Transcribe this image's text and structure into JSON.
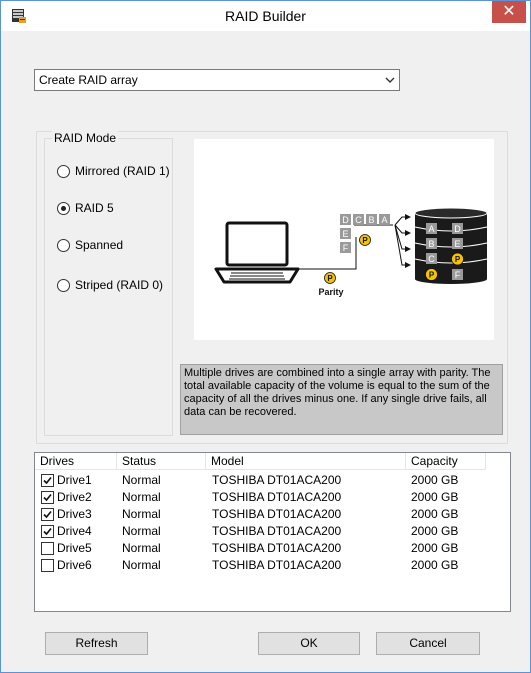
{
  "window": {
    "title": "RAID Builder",
    "close_glyph": "✕"
  },
  "action_select": {
    "value": "Create RAID array"
  },
  "raid_mode": {
    "legend": "RAID Mode",
    "options": [
      {
        "label": "Mirrored (RAID 1)",
        "selected": false
      },
      {
        "label": "RAID 5",
        "selected": true
      },
      {
        "label": "Spanned",
        "selected": false
      },
      {
        "label": "Striped (RAID 0)",
        "selected": false
      }
    ]
  },
  "diagram": {
    "incoming_blocks": [
      "D",
      "C",
      "B",
      "A"
    ],
    "stack_blocks": [
      "E",
      "F"
    ],
    "parity_marker": "P",
    "parity_label": "Parity",
    "disk_rows": [
      [
        "A",
        "D"
      ],
      [
        "B",
        "E"
      ],
      [
        "C",
        "P"
      ],
      [
        "P",
        "F"
      ]
    ]
  },
  "description": "Multiple drives are combined into a single array with parity. The total available capacity of the volume is equal to the sum of the capacity of all the drives minus one. If any single drive fails, all data can be recovered.",
  "drives_table": {
    "columns": [
      "Drives",
      "Status",
      "Model",
      "Capacity"
    ],
    "rows": [
      {
        "name": "Drive1",
        "status": "Normal",
        "model": "TOSHIBA DT01ACA200",
        "capacity": "2000 GB",
        "checked": true
      },
      {
        "name": "Drive2",
        "status": "Normal",
        "model": "TOSHIBA DT01ACA200",
        "capacity": "2000 GB",
        "checked": true
      },
      {
        "name": "Drive3",
        "status": "Normal",
        "model": "TOSHIBA DT01ACA200",
        "capacity": "2000 GB",
        "checked": true
      },
      {
        "name": "Drive4",
        "status": "Normal",
        "model": "TOSHIBA DT01ACA200",
        "capacity": "2000 GB",
        "checked": true
      },
      {
        "name": "Drive5",
        "status": "Normal",
        "model": "TOSHIBA DT01ACA200",
        "capacity": "2000 GB",
        "checked": false
      },
      {
        "name": "Drive6",
        "status": "Normal",
        "model": "TOSHIBA DT01ACA200",
        "capacity": "2000 GB",
        "checked": false
      }
    ]
  },
  "buttons": {
    "refresh": "Refresh",
    "ok": "OK",
    "cancel": "Cancel"
  },
  "colors": {
    "parity_yellow": "#f5c400",
    "block_gray": "#9a9a9a",
    "disk_black": "#1a1a1a",
    "description_bg": "#c8c8c8"
  }
}
